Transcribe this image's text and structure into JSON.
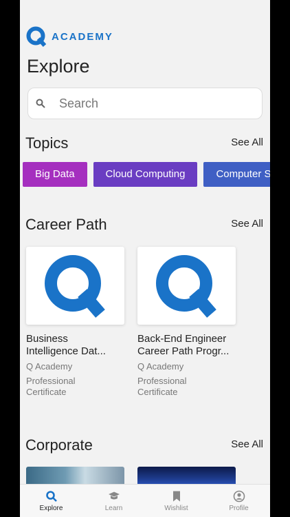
{
  "brand": {
    "name": "ACADEMY",
    "accent": "#1a73c8"
  },
  "page": {
    "title": "Explore"
  },
  "search": {
    "placeholder": "Search"
  },
  "topics": {
    "title": "Topics",
    "see_all": "See All",
    "items": [
      {
        "label": "Big Data",
        "color": "#a52fbf"
      },
      {
        "label": "Cloud Computing",
        "color": "#6a3dc2"
      },
      {
        "label": "Computer S",
        "color": "#3f5fc4"
      }
    ]
  },
  "career_path": {
    "title": "Career Path",
    "see_all": "See All",
    "cards": [
      {
        "title_line1": "Business",
        "title_line2": "Intelligence Dat...",
        "provider": "Q Academy",
        "type": "Professional Certificate"
      },
      {
        "title_line1": "Back-End Engineer",
        "title_line2": "Career Path Progr...",
        "provider": "Q Academy",
        "type": "Professional Certificate"
      }
    ]
  },
  "corporate": {
    "title": "Corporate",
    "see_all": "See All"
  },
  "tabbar": {
    "items": [
      {
        "label": "Explore",
        "icon": "search-icon",
        "active": true
      },
      {
        "label": "Learn",
        "icon": "graduation-cap-icon",
        "active": false
      },
      {
        "label": "Wishlist",
        "icon": "bookmark-icon",
        "active": false
      },
      {
        "label": "Profile",
        "icon": "profile-icon",
        "active": false
      }
    ]
  }
}
